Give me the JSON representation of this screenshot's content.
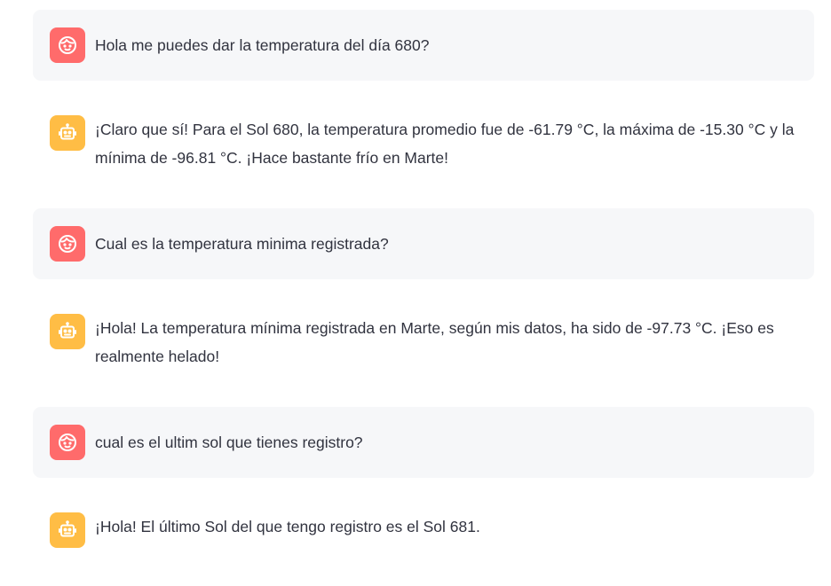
{
  "colors": {
    "user_avatar_bg": "#ff6b6b",
    "assistant_avatar_bg": "#ffbd45",
    "user_bubble_bg": "#f6f7f9",
    "text": "#31333f"
  },
  "messages": [
    {
      "role": "user",
      "icon": "face-icon",
      "text": "Hola me puedes dar la temperatura del día 680?"
    },
    {
      "role": "assistant",
      "icon": "robot-icon",
      "text": "¡Claro que sí! Para el Sol 680, la temperatura promedio fue de -61.79 °C, la máxima de -15.30 °C y la mínima de -96.81 °C. ¡Hace bastante frío en Marte!"
    },
    {
      "role": "user",
      "icon": "face-icon",
      "text": "Cual es la temperatura minima registrada?"
    },
    {
      "role": "assistant",
      "icon": "robot-icon",
      "text": "¡Hola! La temperatura mínima registrada en Marte, según mis datos, ha sido de -97.73 °C. ¡Eso es realmente helado!"
    },
    {
      "role": "user",
      "icon": "face-icon",
      "text": "cual es el ultim sol que tienes registro?"
    },
    {
      "role": "assistant",
      "icon": "robot-icon",
      "text": "¡Hola! El último Sol del que tengo registro es el Sol 681."
    }
  ]
}
